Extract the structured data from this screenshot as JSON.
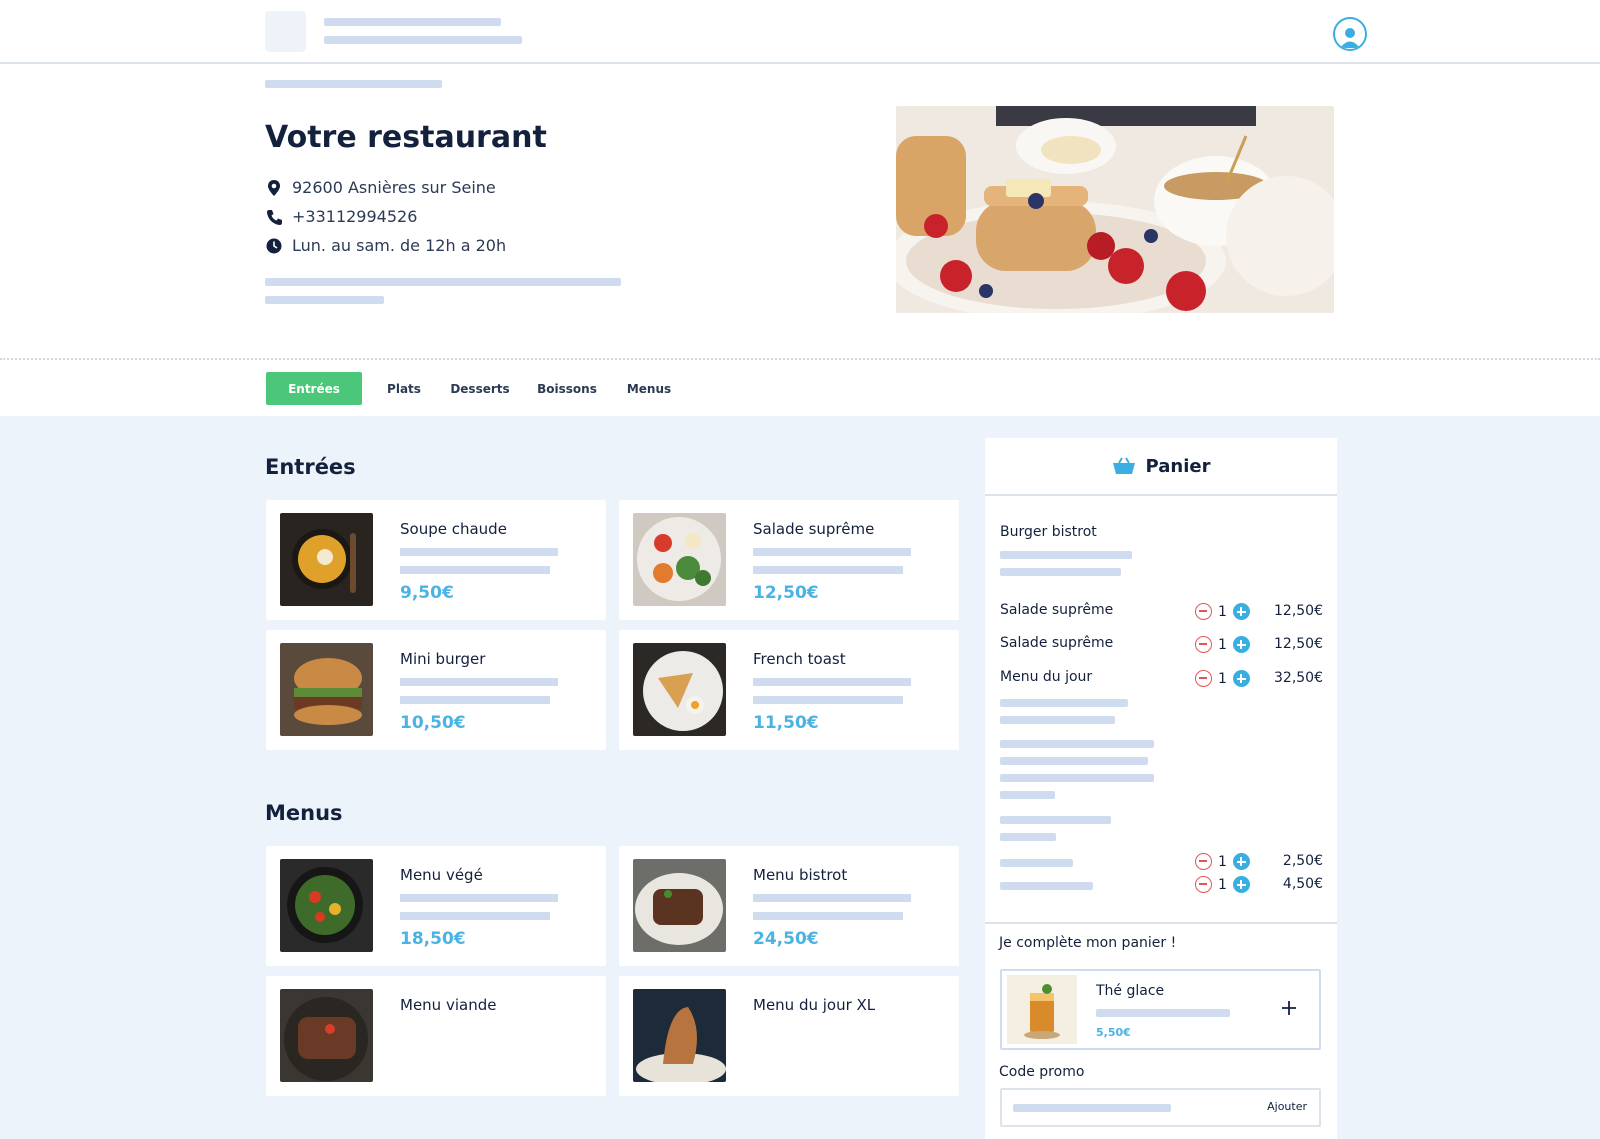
{
  "restaurant": {
    "name": "Votre restaurant",
    "address": "92600 Asnières sur Seine",
    "phone": "+33112994526",
    "hours": "Lun. au sam. de 12h a 20h"
  },
  "tabs": [
    {
      "label": "Entrées",
      "active": true
    },
    {
      "label": "Plats",
      "active": false
    },
    {
      "label": "Desserts",
      "active": false
    },
    {
      "label": "Boissons",
      "active": false
    },
    {
      "label": "Menus",
      "active": false
    }
  ],
  "sections": {
    "entrees": {
      "title": "Entrées",
      "items": [
        {
          "name": "Soupe chaude",
          "price": "9,50€"
        },
        {
          "name": "Salade suprême",
          "price": "12,50€"
        },
        {
          "name": "Mini burger",
          "price": "10,50€"
        },
        {
          "name": "French toast",
          "price": "11,50€"
        }
      ]
    },
    "menus": {
      "title": "Menus",
      "items": [
        {
          "name": "Menu végé",
          "price": "18,50€"
        },
        {
          "name": "Menu bistrot",
          "price": "24,50€"
        },
        {
          "name": "Menu viande",
          "price": ""
        },
        {
          "name": "Menu du jour XL",
          "price": ""
        }
      ]
    }
  },
  "cart": {
    "title": "Panier",
    "header_item": "Burger bistrot",
    "items": [
      {
        "name": "Salade suprême",
        "qty": "1",
        "price": "12,50€"
      },
      {
        "name": "Salade suprême",
        "qty": "1",
        "price": "12,50€"
      },
      {
        "name": "Menu du jour",
        "qty": "1",
        "price": "32,50€"
      },
      {
        "name": "",
        "qty": "1",
        "price": "2,50€"
      },
      {
        "name": "",
        "qty": "1",
        "price": "4,50€"
      }
    ],
    "upsell_title": "Je complète mon panier !",
    "upsell_item": {
      "name": "Thé glace",
      "price": "5,50€"
    },
    "promo_label": "Code promo",
    "promo_button": "Ajouter"
  },
  "colors": {
    "accent_green": "#4cc77a",
    "accent_blue": "#4bb3e3",
    "minus_red": "#e05656",
    "text_dark": "#14213d",
    "placeholder": "#cfdcef",
    "page_bg": "#edf3fa"
  }
}
